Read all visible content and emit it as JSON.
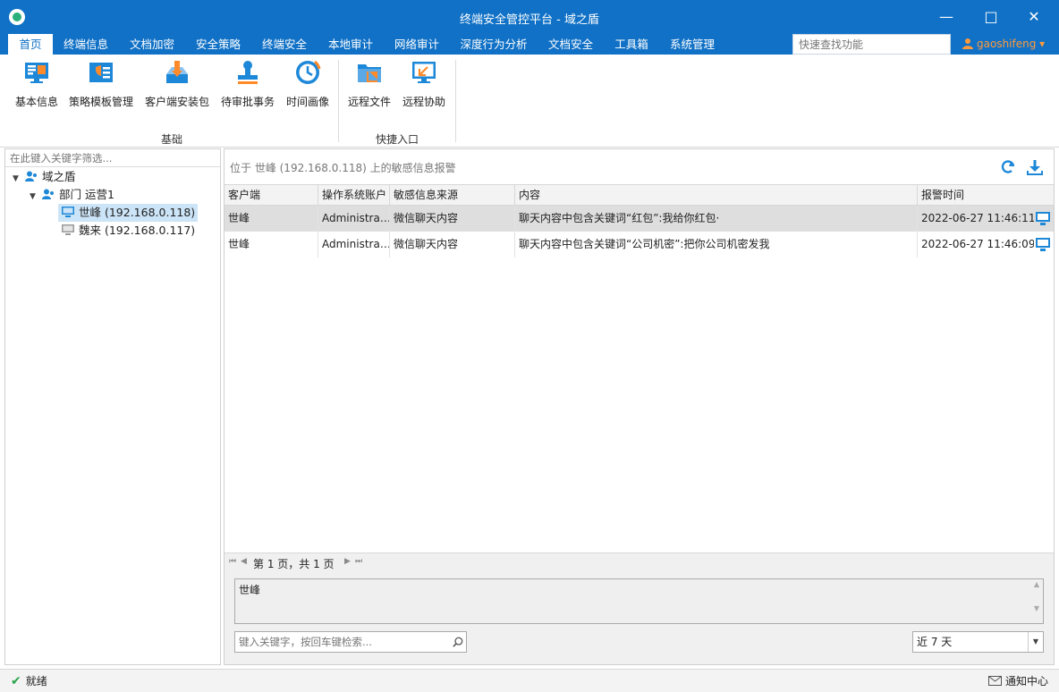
{
  "window": {
    "title": "终端安全管控平台 - 域之盾"
  },
  "menu": {
    "items": [
      "首页",
      "终端信息",
      "文档加密",
      "安全策略",
      "终端安全",
      "本地审计",
      "网络审计",
      "深度行为分析",
      "文档安全",
      "工具箱",
      "系统管理"
    ],
    "active": "首页",
    "quick_search_placeholder": "快速查找功能",
    "user": "gaoshifeng ▾"
  },
  "ribbon": {
    "groups": [
      {
        "label": "基础",
        "buttons": [
          "基本信息",
          "策略模板管理",
          "客户端安装包",
          "待审批事务",
          "时间画像"
        ]
      },
      {
        "label": "快捷入口",
        "buttons": [
          "远程文件",
          "远程协助"
        ]
      }
    ]
  },
  "tree": {
    "filter_placeholder": "在此键入关键字筛选...",
    "root": "域之盾",
    "dept": "部门 运营1",
    "nodes": [
      "世峰 (192.168.0.118)",
      "魏来 (192.168.0.117)"
    ]
  },
  "main": {
    "location": "位于 世峰 (192.168.0.118) 上的敏感信息报警",
    "columns": [
      "客户端",
      "操作系统账户",
      "敏感信息来源",
      "内容",
      "报警时间"
    ],
    "rows": [
      [
        "世峰",
        "Administra…",
        "微信聊天内容",
        "聊天内容中包含关键词“红包”:我给你红包·",
        "2022-06-27 11:46:11"
      ],
      [
        "世峰",
        "Administra…",
        "微信聊天内容",
        "聊天内容中包含关键词“公司机密”:把你公司机密发我",
        "2022-06-27 11:46:09"
      ]
    ],
    "pager_text": "第 1 页，共 1 页",
    "detail_text": "世峰",
    "search_placeholder": "键入关键字，按回车键检索...",
    "range": "近 7 天"
  },
  "status": {
    "left": "就绪",
    "right": "通知中心"
  },
  "colors": {
    "brand": "#1071c6",
    "accent": "#ff9a3c",
    "icon_blue": "#1e88d8"
  }
}
